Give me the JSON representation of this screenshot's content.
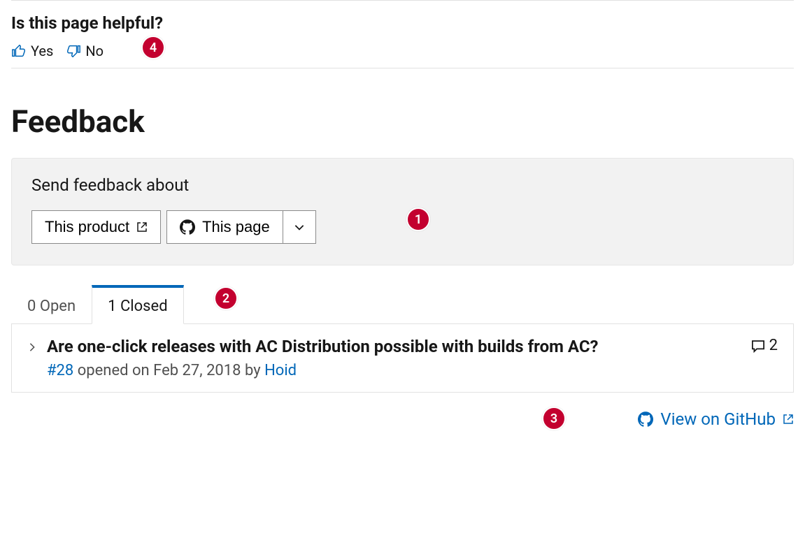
{
  "helpful": {
    "title": "Is this page helpful?",
    "yes_label": "Yes",
    "no_label": "No"
  },
  "feedback": {
    "heading": "Feedback",
    "send_label": "Send feedback about",
    "product_button": "This product",
    "page_button": "This page"
  },
  "tabs": {
    "open_label": "0 Open",
    "closed_label": "1 Closed"
  },
  "issue": {
    "title": "Are one-click releases with AC Distribution possible with builds from AC?",
    "comments": "2",
    "ref": "#28",
    "meta_mid": " opened on Feb 27, 2018 by ",
    "author": "Hoid"
  },
  "footer": {
    "view_label": "View on GitHub"
  },
  "callouts": {
    "c1": "1",
    "c2": "2",
    "c3": "3",
    "c4": "4"
  }
}
